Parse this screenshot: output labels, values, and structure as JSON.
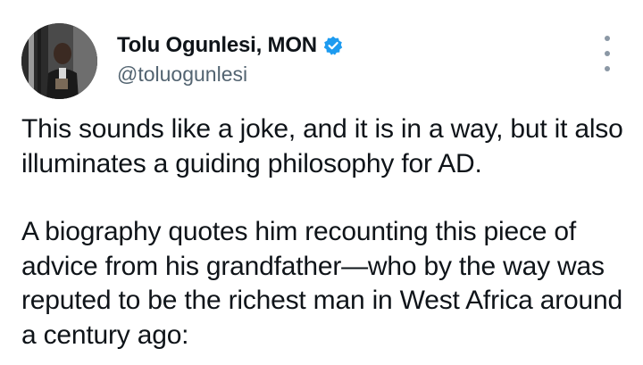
{
  "author": {
    "display_name": "Tolu Ogunlesi, MON",
    "handle": "@toluogunlesi",
    "verified_icon": "verified-badge-icon",
    "verified_color": "#1d9bf0"
  },
  "menu": {
    "icon": "more-vertical-icon"
  },
  "tweet": {
    "paragraph_1": "This sounds like a joke, and it is in a way, but it also illuminates a guiding philosophy for AD.",
    "paragraph_2": "A biography quotes him recounting this piece of advice from his grandfather—who by the way was reputed to be the richest man in West Africa around a century ago:"
  },
  "colors": {
    "text": "#0f1419",
    "secondary": "#536471",
    "background": "#ffffff"
  }
}
